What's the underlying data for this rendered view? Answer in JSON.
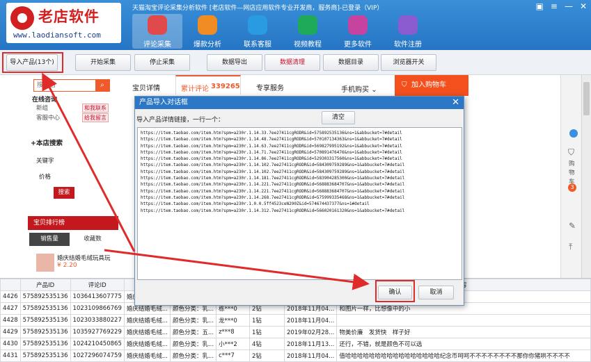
{
  "app": {
    "title": "天猫淘宝评论采集分析软件 [老店软件—网店应用软件专业开发商，服务商]-已登录（VIP）",
    "logo_name": "老店软件",
    "logo_url": "www.laodiansoft.com",
    "brand_color": "#d21f1f",
    "header_color": "#2575c4"
  },
  "nav": [
    {
      "label": "评论采集",
      "icon": "chat-icon",
      "color": "#e04a4a"
    },
    {
      "label": "爆款分析",
      "icon": "pie-chart-icon",
      "color": "#f08c23"
    },
    {
      "label": "联系客服",
      "icon": "penguin-icon",
      "color": "#2a9be0"
    },
    {
      "label": "视频教程",
      "icon": "play-icon",
      "color": "#1faa5a"
    },
    {
      "label": "更多软件",
      "icon": "box-icon",
      "color": "#c6449f"
    },
    {
      "label": "软件注册",
      "icon": "user-icon",
      "color": "#8a5ccf"
    }
  ],
  "toolbar": {
    "import": "导入产品(13个)",
    "start": "开始采集",
    "stop": "停止采集",
    "export": "数据导出",
    "clean": "数据清理",
    "dir": "数据目录",
    "browser": "浏览器开关"
  },
  "shop": {
    "search_placeholder": "搜本店",
    "online": "在线咨询",
    "group": "新组",
    "service": "客服中心",
    "contact_btn": "和我联系",
    "msg_btn": "给我留言",
    "tab_detail": "宝贝详情",
    "tab_reviews": "累计评论",
    "reviews_count": "339265",
    "tab_service": "专享服务",
    "mobile": "手机购买",
    "cart_btn": "加入购物车",
    "search_title": "+本店搜索",
    "keyword": "关键字",
    "price": "价格",
    "search_btn": "搜索",
    "rank_title": "宝贝排行榜",
    "rank_tab1": "销售量",
    "rank_tab2": "收藏数",
    "rank_item": "婚庆结婚毛绒玩具玩",
    "rank_price": "¥ 2.20",
    "side_cart": "购物车",
    "cart_count": "3"
  },
  "modal": {
    "title": "产品导入对话框",
    "hint": "导入产品详情链接，一行一个：",
    "clear": "清空",
    "ok": "确认",
    "cancel": "取消",
    "urls": [
      "https://item.taobao.com/item.htm?spm=a230r.1.14.33.7ee27411cgRODR&id=575892535136&ns=1&abbucket=7#detail",
      "https://item.taobao.com/item.htm?spm=a230r.1.14.48.7ee27411cgRODR&id=570107134363&ns=1&abbucket=7#detail",
      "https://item.taobao.com/item.htm?spm=a230r.1.14.63.7ee27411cgRODR&id=569827995192&ns=1&abbucket=7#detail",
      "https://item.taobao.com/item.htm?spm=a230r.1.14.71.7ee27411cgRODR&id=570891476476&ns=1&abbucket=7#detail",
      "https://item.taobao.com/item.htm?spm=a230r.1.14.86.7ee27411cgRODR&id=529303317560&ns=1&abbucket=7#detail",
      "https://item.taobao.com/item.htm?spm=a230r.1.14.102.7ee27411cgRODR&id=584309759289&ns=1&abbucket=7#detail",
      "https://item.taobao.com/item.htm?spm=a230r.1.14.102.7ee27411cgRODR&id=584309759289&ns=1&abbucket=7#detail",
      "https://item.taobao.com/item.htm?spm=a230r.1.14.181.7ee27411cgRODR&id=583904285300&ns=1&abbucket=7#detail",
      "https://item.taobao.com/item.htm?spm=a230r.1.14.221.7ee27411cgRODR&id=568883684707&ns=1&abbucket=7#detail",
      "https://item.taobao.com/item.htm?spm=a230r.1.14.221.7ee27411cgRODR&id=568883684707&ns=1&abbucket=7#detail",
      "https://item.taobao.com/item.htm?spm=a230r.1.14.268.7ee27411cgRODR&id=575999335468&ns=1&abbucket=7#detail",
      "https://item.taobao.com/item.htm?spm=a230r.1.0.0.5ff4523ceN290Z&id=574674437377&ns=1#detail",
      "https://item.taobao.com/item.htm?spm=a230r.1.14.312.7ee27411cgRODR&id=566020161320&ns=1&abbucket=7#detail"
    ]
  },
  "grid": {
    "headers": [
      "",
      "产品ID",
      "评论ID",
      "产品",
      "",
      "",
      "",
      "",
      "",
      "容"
    ],
    "rows": [
      [
        "4426",
        "575892535136",
        "1036413607775",
        "婚庆结婚毛绒...",
        "颜色分类：深...",
        "我***邋",
        "2钻",
        "2018年11月04...",
        "拍的蓝色药丸 结果收到红色的"
      ],
      [
        "4427",
        "575892535136",
        "1023109866769",
        "婚庆结婚毛绒...",
        "颜色分类：乳...",
        "栋***0",
        "2钻",
        "2018年11月04...",
        "和图片一样，比想像中的小"
      ],
      [
        "4428",
        "575892535136",
        "1023033880227",
        "婚庆结婚毛绒...",
        "颜色分类：乳...",
        "龙***0",
        "1钻",
        "2018年11月04...",
        ""
      ],
      [
        "4429",
        "575892535136",
        "1035927769229",
        "婚庆结婚毛绒...",
        "颜色分类：五...",
        "z***8",
        "1钻",
        "2019年02月28...",
        "物美价廉　发货快　样子好"
      ],
      [
        "4430",
        "575892535136",
        "1024210450865",
        "婚庆结婚毛绒...",
        "颜色分类：乳...",
        "小***2",
        "4钻",
        "2018年11月13...",
        "还行，不错，就是颜色不可以选"
      ],
      [
        "4431",
        "575892535136",
        "1027296074759",
        "婚庆结婚毛绒...",
        "颜色分类：乳...",
        "c***7",
        "2钻",
        "2018年11月04...",
        "值哈哈哈哈哈哈哈哈哈哈哈哈哈哈哈哈纪念币呵呵不不不不不不不不那你你猪哄不不不不"
      ]
    ]
  }
}
